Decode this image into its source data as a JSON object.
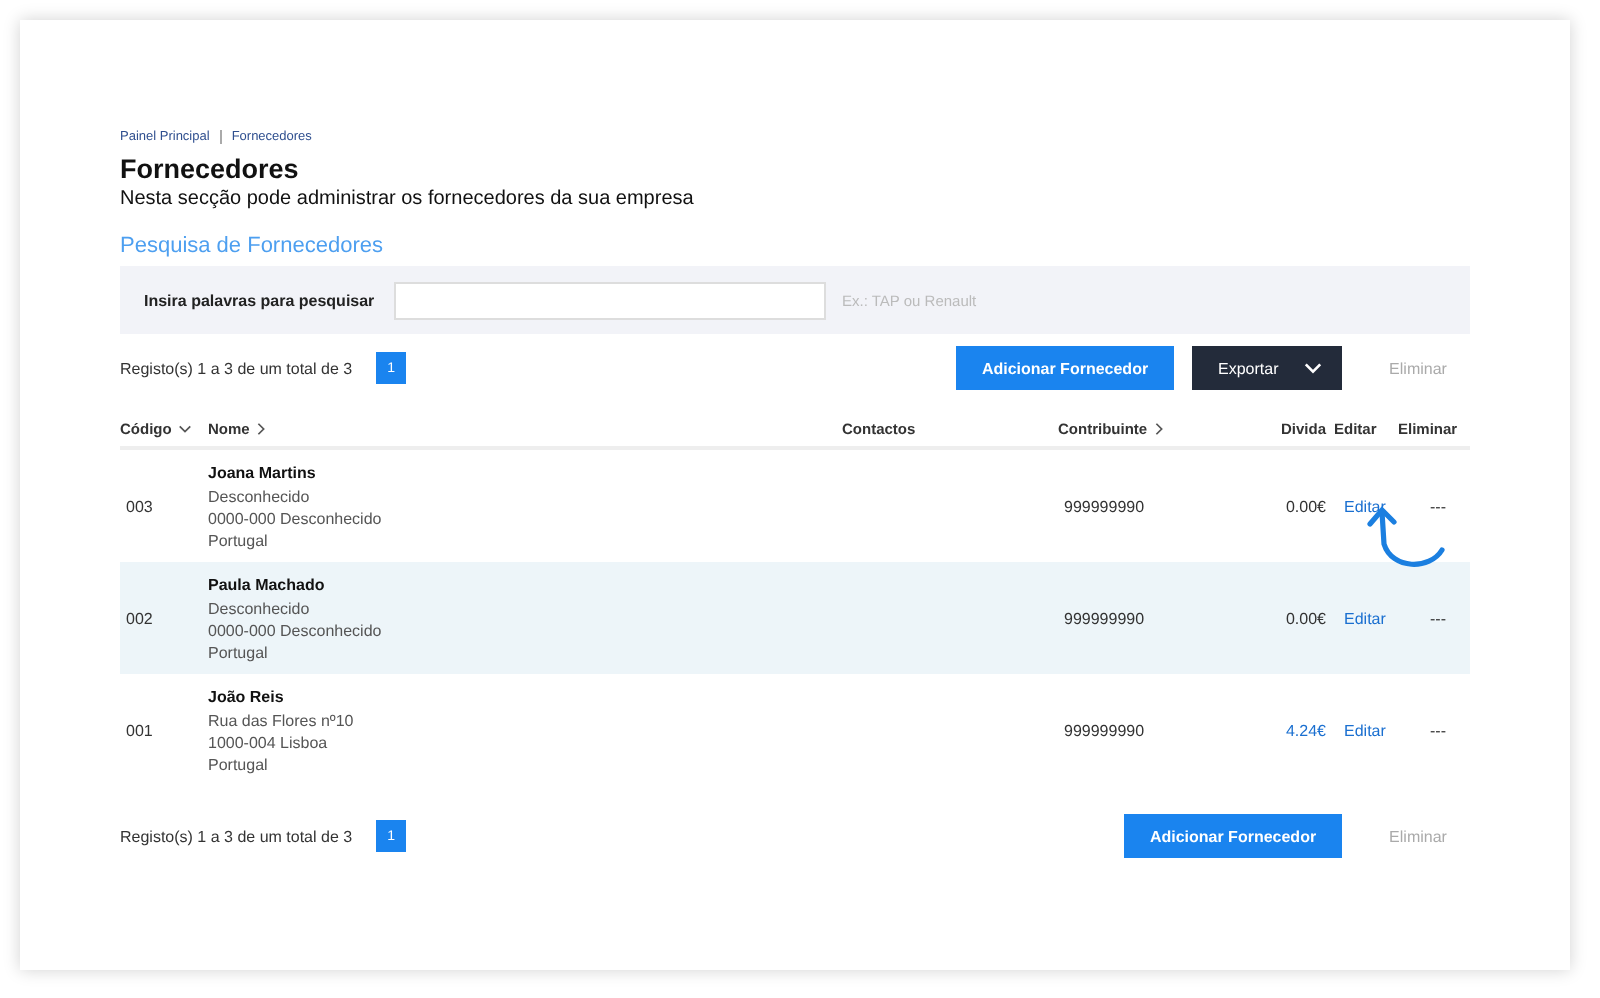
{
  "breadcrumb": [
    "Painel Principal",
    "Fornecedores"
  ],
  "title": "Fornecedores",
  "subtitle": "Nesta secção pode administrar os fornecedores da sua empresa",
  "search_section": {
    "heading": "Pesquisa de Fornecedores",
    "label": "Insira palavras para pesquisar",
    "hint": "Ex.: TAP ou Renault"
  },
  "top_toolbar": {
    "records": "Registo(s) 1 a 3 de um total de 3",
    "pages": [
      {
        "label": "1",
        "selected": true
      }
    ],
    "add_button": "Adicionar Fornecedor",
    "export_button": "Exportar",
    "delete_button": "Eliminar",
    "delete_disabled": true
  },
  "table": {
    "columns": [
      {
        "label": "Código",
        "sorted": true
      },
      {
        "label": "Nome",
        "sorted": false
      },
      {
        "label": "Contactos"
      },
      {
        "label": "Contribuinte",
        "sorted": false
      },
      {
        "label": "Divida"
      },
      {
        "label": "Editar"
      },
      {
        "label": "Eliminar"
      }
    ],
    "rows": [
      {
        "code": "003",
        "name": "Joana Martins",
        "address": [
          "Desconhecido",
          "0000-000 Desconhecido",
          "Portugal"
        ],
        "taxid": "999999990",
        "debt": "0.00€",
        "debt_link": false,
        "edit": "Editar",
        "delete": "---",
        "highlighted": false
      },
      {
        "code": "002",
        "name": "Paula Machado",
        "address": [
          "Desconhecido",
          "0000-000 Desconhecido",
          "Portugal"
        ],
        "taxid": "999999990",
        "debt": "0.00€",
        "debt_link": false,
        "edit": "Editar",
        "delete": "---",
        "highlighted": true
      },
      {
        "code": "001",
        "name": "João Reis",
        "address": [
          "Rua das Flores nº10",
          "1000-004 Lisboa",
          "Portugal"
        ],
        "taxid": "999999990",
        "debt": "4.24€",
        "debt_link": true,
        "edit": "Editar",
        "delete": "---",
        "highlighted": false
      }
    ]
  },
  "bottom_toolbar": {
    "records": "Registo(s) 1 a 3 de um total de 3",
    "pages": [
      {
        "label": "1",
        "selected": true
      }
    ],
    "add_button": "Adicionar Fornecedor",
    "delete_button": "Eliminar",
    "delete_disabled": true
  }
}
